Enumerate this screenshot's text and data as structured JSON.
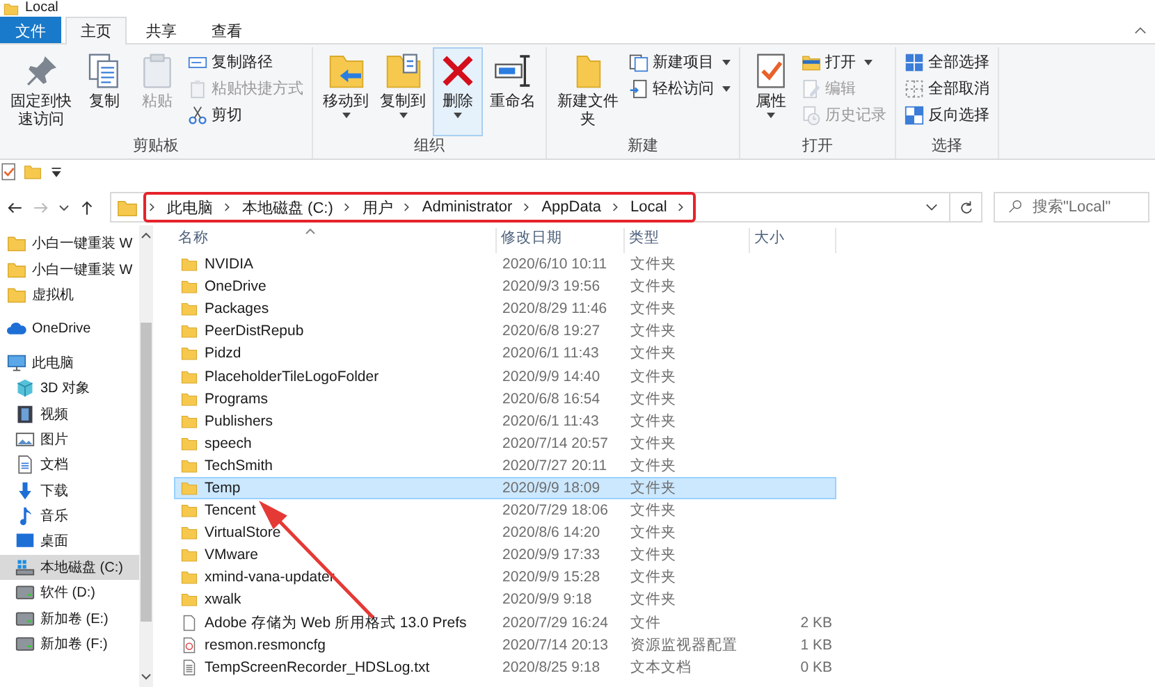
{
  "window": {
    "title": "Local"
  },
  "ribbon_tabs": [
    {
      "label": "文件",
      "kind": "file",
      "selected": false
    },
    {
      "label": "主页",
      "kind": "tab",
      "selected": true
    },
    {
      "label": "共享",
      "kind": "tab",
      "selected": false
    },
    {
      "label": "查看",
      "kind": "tab",
      "selected": false
    }
  ],
  "ribbon_groups": [
    {
      "label": "剪贴板",
      "large": [
        {
          "label": "固定到快速访问",
          "disabled": false,
          "highlighted": false
        },
        {
          "label": "复制",
          "disabled": false,
          "highlighted": false
        },
        {
          "label": "粘贴",
          "disabled": true,
          "highlighted": false
        }
      ],
      "small": [
        {
          "label": "复制路径",
          "disabled": false,
          "dropdown": false
        },
        {
          "label": "粘贴快捷方式",
          "disabled": true,
          "dropdown": false
        },
        {
          "label": "剪切",
          "disabled": false,
          "dropdown": false
        }
      ]
    },
    {
      "label": "组织",
      "large": [
        {
          "label": "移动到",
          "disabled": false,
          "dropdown": true,
          "highlighted": false
        },
        {
          "label": "复制到",
          "disabled": false,
          "dropdown": true,
          "highlighted": false
        },
        {
          "label": "删除",
          "disabled": false,
          "dropdown": true,
          "highlighted": true
        },
        {
          "label": "重命名",
          "disabled": false,
          "highlighted": false
        }
      ]
    },
    {
      "label": "新建",
      "large": [
        {
          "label": "新建文件夹",
          "disabled": false,
          "highlighted": false
        }
      ],
      "small": [
        {
          "label": "新建项目",
          "disabled": false,
          "dropdown": true
        },
        {
          "label": "轻松访问",
          "disabled": false,
          "dropdown": true
        }
      ]
    },
    {
      "label": "打开",
      "large": [
        {
          "label": "属性",
          "disabled": false,
          "dropdown": true,
          "highlighted": false
        }
      ],
      "small": [
        {
          "label": "打开",
          "disabled": false,
          "dropdown": true
        },
        {
          "label": "编辑",
          "disabled": true,
          "dropdown": false
        },
        {
          "label": "历史记录",
          "disabled": true,
          "dropdown": false
        }
      ]
    },
    {
      "label": "选择",
      "small": [
        {
          "label": "全部选择",
          "disabled": false,
          "dropdown": false
        },
        {
          "label": "全部取消",
          "disabled": false,
          "dropdown": false
        },
        {
          "label": "反向选择",
          "disabled": false,
          "dropdown": false
        }
      ]
    }
  ],
  "address": {
    "crumbs": [
      "此电脑",
      "本地磁盘 (C:)",
      "用户",
      "Administrator",
      "AppData",
      "Local"
    ]
  },
  "search": {
    "placeholder": "搜索\"Local\""
  },
  "sidebar": {
    "items": [
      {
        "label": "小白一键重装 W",
        "kind": "folder",
        "selected": false
      },
      {
        "label": "小白一键重装 W",
        "kind": "folder",
        "selected": false
      },
      {
        "label": "虚拟机",
        "kind": "folder",
        "selected": false
      },
      {
        "label": "OneDrive",
        "kind": "cloud",
        "selected": false
      },
      {
        "label": "此电脑",
        "kind": "pc",
        "selected": false,
        "children": [
          {
            "label": "3D 对象",
            "kind": "cube",
            "selected": false
          },
          {
            "label": "视频",
            "kind": "film",
            "selected": false
          },
          {
            "label": "图片",
            "kind": "picture",
            "selected": false
          },
          {
            "label": "文档",
            "kind": "doc",
            "selected": false
          },
          {
            "label": "下载",
            "kind": "download",
            "selected": false
          },
          {
            "label": "音乐",
            "kind": "music",
            "selected": false
          },
          {
            "label": "桌面",
            "kind": "desktop",
            "selected": false
          },
          {
            "label": "本地磁盘 (C:)",
            "kind": "sysdrive",
            "selected": true
          },
          {
            "label": "软件 (D:)",
            "kind": "drive",
            "selected": false
          },
          {
            "label": "新加卷 (E:)",
            "kind": "drive",
            "selected": false
          },
          {
            "label": "新加卷 (F:)",
            "kind": "drive",
            "selected": false
          }
        ]
      }
    ]
  },
  "file_list": {
    "columns": [
      "名称",
      "修改日期",
      "类型",
      "大小"
    ],
    "rows": [
      {
        "name": "NVIDIA",
        "date": "2020/6/10 10:11",
        "type": "文件夹",
        "kind": "folder",
        "selected": false
      },
      {
        "name": "OneDrive",
        "date": "2020/9/3 19:56",
        "type": "文件夹",
        "kind": "folder",
        "selected": false
      },
      {
        "name": "Packages",
        "date": "2020/8/29 11:46",
        "type": "文件夹",
        "kind": "folder",
        "selected": false
      },
      {
        "name": "PeerDistRepub",
        "date": "2020/6/8 19:27",
        "type": "文件夹",
        "kind": "folder",
        "selected": false
      },
      {
        "name": "Pidzd",
        "date": "2020/6/1 11:43",
        "type": "文件夹",
        "kind": "folder",
        "selected": false
      },
      {
        "name": "PlaceholderTileLogoFolder",
        "date": "2020/9/9 14:40",
        "type": "文件夹",
        "kind": "folder",
        "selected": false
      },
      {
        "name": "Programs",
        "date": "2020/6/8 16:54",
        "type": "文件夹",
        "kind": "folder",
        "selected": false
      },
      {
        "name": "Publishers",
        "date": "2020/6/1 11:43",
        "type": "文件夹",
        "kind": "folder",
        "selected": false
      },
      {
        "name": "speech",
        "date": "2020/7/14 20:57",
        "type": "文件夹",
        "kind": "folder",
        "selected": false
      },
      {
        "name": "TechSmith",
        "date": "2020/7/27 20:11",
        "type": "文件夹",
        "kind": "folder",
        "selected": false
      },
      {
        "name": "Temp",
        "date": "2020/9/9 18:09",
        "type": "文件夹",
        "kind": "folder",
        "selected": true
      },
      {
        "name": "Tencent",
        "date": "2020/7/29 18:06",
        "type": "文件夹",
        "kind": "folder",
        "selected": false
      },
      {
        "name": "VirtualStore",
        "date": "2020/8/6 14:20",
        "type": "文件夹",
        "kind": "folder",
        "selected": false
      },
      {
        "name": "VMware",
        "date": "2020/9/9 17:33",
        "type": "文件夹",
        "kind": "folder",
        "selected": false
      },
      {
        "name": "xmind-vana-updater",
        "date": "2020/9/9 15:28",
        "type": "文件夹",
        "kind": "folder",
        "selected": false
      },
      {
        "name": "xwalk",
        "date": "2020/9/9 9:18",
        "type": "文件夹",
        "kind": "folder",
        "selected": false
      },
      {
        "name": "Adobe 存储为 Web 所用格式 13.0 Prefs",
        "date": "2020/7/29 16:24",
        "type": "文件",
        "size": "2 KB",
        "kind": "file",
        "selected": false
      },
      {
        "name": "resmon.resmoncfg",
        "date": "2020/7/14 20:13",
        "type": "资源监视器配置",
        "size": "1 KB",
        "kind": "config",
        "selected": false
      },
      {
        "name": "TempScreenRecorder_HDSLog.txt",
        "date": "2020/8/25 9:18",
        "type": "文本文档",
        "size": "0 KB",
        "kind": "text",
        "selected": false
      }
    ]
  }
}
